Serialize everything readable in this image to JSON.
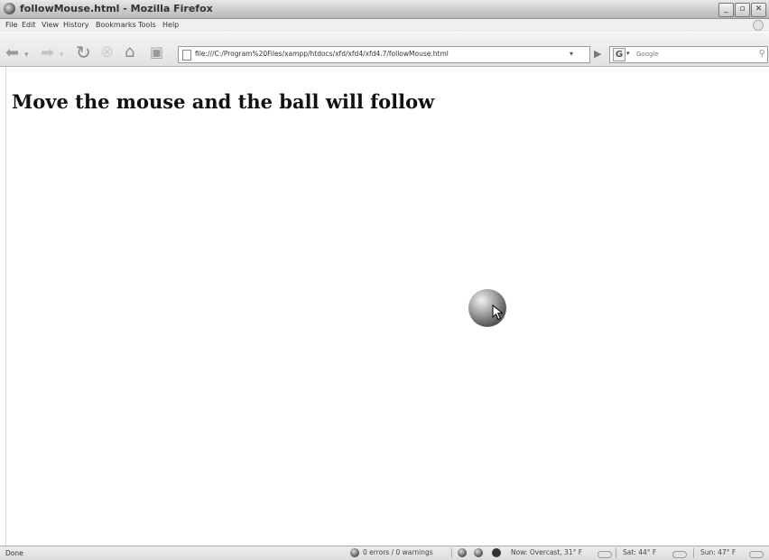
{
  "window": {
    "title": "followMouse.html - Mozilla Firefox",
    "buttons": {
      "minimize": "_",
      "restore": "▫",
      "close": "✕"
    }
  },
  "menu": {
    "items": [
      "File",
      "Edit",
      "View",
      "History",
      "Bookmarks",
      "Tools",
      "Help"
    ]
  },
  "toolbar": {
    "url": "file:///C:/Program%20Files/xampp/htdocs/xfd/xfd4/xfd4.7/followMouse.html",
    "search_engine": "G",
    "search_placeholder": "Google"
  },
  "page": {
    "heading": "Move the mouse and the ball will follow"
  },
  "status": {
    "text": "Done",
    "errors": "0 errors / 0 warnings",
    "weather_now": "Now: Overcast, 31° F",
    "weather_sat": "Sat: 44° F",
    "weather_sun": "Sun: 47° F"
  },
  "icons": [
    "firefox-icon",
    "back-icon",
    "forward-icon",
    "reload-icon",
    "stop-icon",
    "home-icon",
    "bookmark-icon",
    "go-icon",
    "search-icon",
    "cloud-icon",
    "ball-icon",
    "cursor-icon"
  ]
}
